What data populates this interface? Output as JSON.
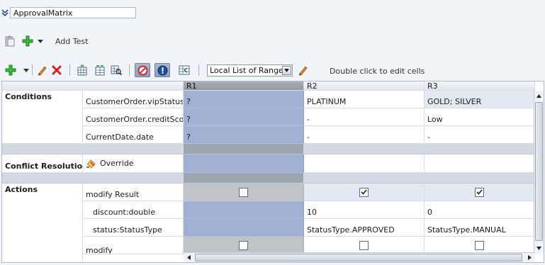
{
  "title_field": {
    "value": "ApprovalMatrix"
  },
  "test_toolbar": {
    "add_test_label": "Add Test"
  },
  "grid_toolbar": {
    "range_select_value": "Local List of Ranges",
    "hint": "Double click to edit cells"
  },
  "table": {
    "columns": [
      "R1",
      "R2",
      "R3"
    ],
    "sections": {
      "conditions": "Conditions",
      "conflict": "Conflict Resolution",
      "actions": "Actions"
    },
    "conditions": [
      {
        "label": "CustomerOrder.vipStatus",
        "values": [
          "?",
          "PLATINUM",
          "GOLD; SILVER"
        ]
      },
      {
        "label": "CustomerOrder.creditScore",
        "values": [
          "?",
          "-",
          "Low"
        ]
      },
      {
        "label": "CurrentDate.date",
        "values": [
          "?",
          "-",
          "-"
        ]
      }
    ],
    "conflict": {
      "label": "Override"
    },
    "actions": [
      {
        "label": "modify Result",
        "checks": [
          false,
          true,
          true
        ]
      },
      {
        "label": "discount:double",
        "values": [
          "",
          "10",
          "0"
        ]
      },
      {
        "label": "status:StatusType",
        "values": [
          "",
          "StatusType.APPROVED",
          "StatusType.MANUAL"
        ]
      },
      {
        "label": "modify",
        "checks": [
          false,
          false,
          false
        ]
      }
    ]
  }
}
